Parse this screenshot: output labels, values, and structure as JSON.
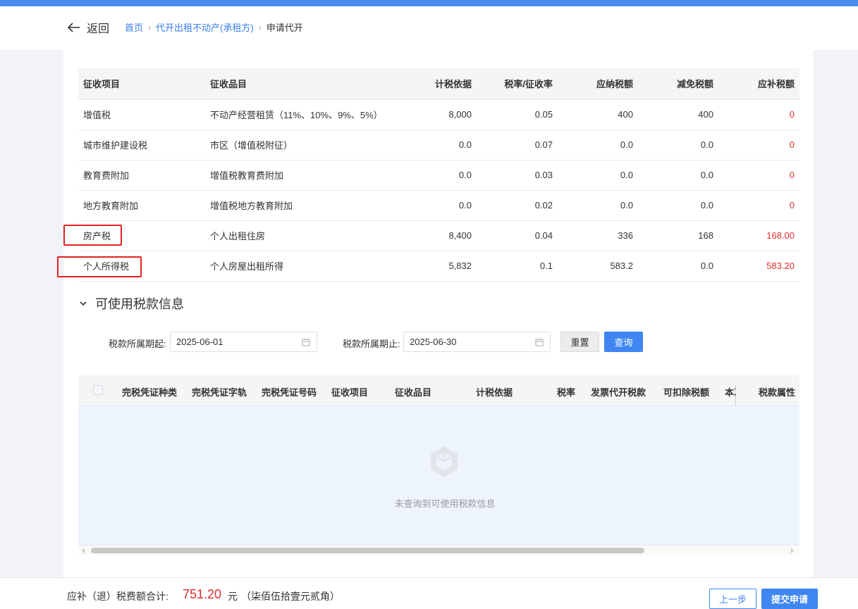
{
  "header": {
    "back_label": "返回",
    "breadcrumb": [
      "首页",
      "代开出租不动产(承租方)",
      "申请代开"
    ]
  },
  "tax_table": {
    "columns": [
      "征收项目",
      "征收品目",
      "计税依据",
      "税率/征收率",
      "应纳税额",
      "减免税额",
      "应补税额"
    ],
    "rows": [
      [
        "增值税",
        "不动产经营租赁（11%、10%、9%、5%）",
        "8,000",
        "0.05",
        "400",
        "400",
        "0"
      ],
      [
        "城市维护建设税",
        "市区（增值税附征）",
        "0.0",
        "0.07",
        "0.0",
        "0.0",
        "0"
      ],
      [
        "教育费附加",
        "增值税教育费附加",
        "0.0",
        "0.03",
        "0.0",
        "0.0",
        "0"
      ],
      [
        "地方教育附加",
        "增值税地方教育附加",
        "0.0",
        "0.02",
        "0.0",
        "0.0",
        "0"
      ],
      [
        "房产税",
        "个人出租住房",
        "8,400",
        "0.04",
        "336",
        "168",
        "168.00"
      ],
      [
        "个人所得税",
        "个人房屋出租所得",
        "5,832",
        "0.1",
        "583.2",
        "0.0",
        "583.20"
      ]
    ],
    "highlighted_rows": [
      "房产税",
      "个人所得税"
    ],
    "highlight_color": "#e52020",
    "amount_color": "#e02c2c"
  },
  "section": {
    "title": "可使用税款信息"
  },
  "filters": {
    "start_label": "税款所属期起:",
    "start_value": "2025-06-01",
    "end_label": "税款所属期止:",
    "end_value": "2025-06-30",
    "reset_label": "重置",
    "query_label": "查询"
  },
  "credit_table": {
    "columns": [
      "完税凭证种类",
      "完税凭证字轨",
      "完税凭证号码",
      "征收项目",
      "征收品目",
      "计税依据",
      "税率",
      "发票代开税款",
      "可扣除税额",
      "本次",
      "税款属性"
    ],
    "empty_text": "未查询到可使用税款信息"
  },
  "footer": {
    "total_label": "应补（退）税费额合计:",
    "total_amount": "751.20",
    "unit": "元",
    "amount_in_words": "（柒佰伍拾壹元贰角）",
    "prev_label": "上一步",
    "submit_label": "提交申请"
  },
  "colors": {
    "accent": "#3f86f1",
    "top_bar": "#4a8cf0"
  }
}
